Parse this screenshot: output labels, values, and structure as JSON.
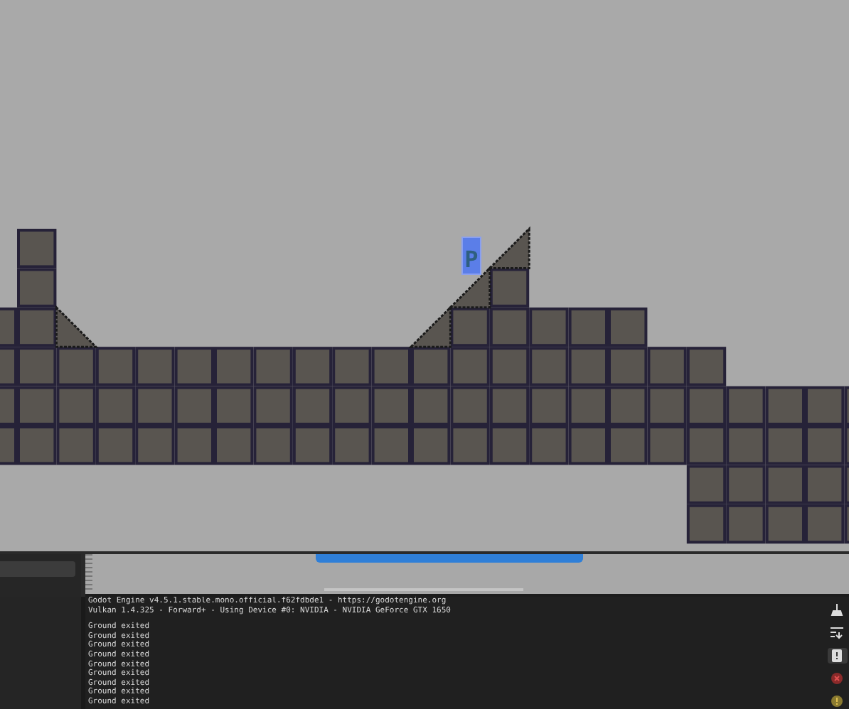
{
  "player": {
    "label": "P"
  },
  "output": {
    "header": [
      "Godot Engine v4.5.1.stable.mono.official.f62fdbde1 - https://godotengine.org",
      "Vulkan 1.4.325 - Forward+ - Using Device #0: NVIDIA - NVIDIA GeForce GTX 1650"
    ],
    "lines": [
      "Ground exited",
      "Ground exited",
      "Ground exited",
      "Ground exited",
      "Ground exited",
      "Ground exited",
      "Ground exited",
      "Ground exited",
      "Ground exited"
    ]
  },
  "output_filters": [
    {
      "kind": "clear",
      "selected": false
    },
    {
      "kind": "wrap",
      "selected": false
    },
    {
      "kind": "log",
      "selected": true
    },
    {
      "kind": "error",
      "selected": false
    },
    {
      "kind": "warning",
      "selected": false
    }
  ]
}
